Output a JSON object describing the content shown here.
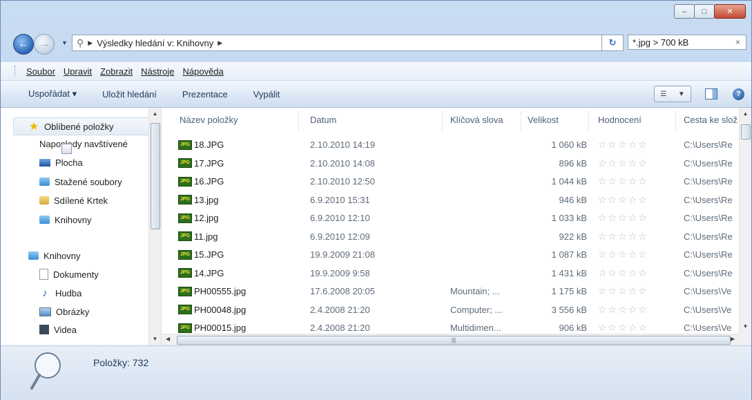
{
  "window": {
    "controls": {
      "minimize": "‒",
      "maximize": "□",
      "close": "✕"
    }
  },
  "address": {
    "breadcrumb": "Výsledky hledání v: Knihovny",
    "search_value": "*.jpg > 700 kB",
    "search_clear": "×"
  },
  "menu": [
    "Soubor",
    "Upravit",
    "Zobrazit",
    "Nástroje",
    "Nápověda"
  ],
  "commands": [
    "Uspořádat ▾",
    "Uložit hledání",
    "Prezentace",
    "Vypálit"
  ],
  "nav": {
    "favorites": {
      "label": "Oblíbené položky",
      "items": [
        "Naposledy navštívené",
        "Plocha",
        "Stažené soubory",
        "Sdílené Krtek",
        "Knihovny"
      ]
    },
    "libraries": {
      "label": "Knihovny",
      "items": [
        "Dokumenty",
        "Hudba",
        "Obrázky",
        "Videa"
      ]
    }
  },
  "columns": [
    "Název položky",
    "Datum",
    "Klíčová slova",
    "Velikost",
    "Hodnocení",
    "Cesta ke složce"
  ],
  "file_badge": "JPG",
  "rows": [
    {
      "name": "18.JPG",
      "date": "2.10.2010 14:19",
      "keywords": "",
      "size": "1 060 kB",
      "rating": "☆☆☆☆☆",
      "path": "C:\\Users\\Re"
    },
    {
      "name": "17.JPG",
      "date": "2.10.2010 14:08",
      "keywords": "",
      "size": "896 kB",
      "rating": "☆☆☆☆☆",
      "path": "C:\\Users\\Re"
    },
    {
      "name": "16.JPG",
      "date": "2.10.2010 12:50",
      "keywords": "",
      "size": "1 044 kB",
      "rating": "☆☆☆☆☆",
      "path": "C:\\Users\\Re"
    },
    {
      "name": "13.jpg",
      "date": "6.9.2010 15:31",
      "keywords": "",
      "size": "946 kB",
      "rating": "☆☆☆☆☆",
      "path": "C:\\Users\\Re"
    },
    {
      "name": "12.jpg",
      "date": "6.9.2010 12:10",
      "keywords": "",
      "size": "1 033 kB",
      "rating": "☆☆☆☆☆",
      "path": "C:\\Users\\Re"
    },
    {
      "name": "11.jpg",
      "date": "6.9.2010 12:09",
      "keywords": "",
      "size": "922 kB",
      "rating": "☆☆☆☆☆",
      "path": "C:\\Users\\Re"
    },
    {
      "name": "15.JPG",
      "date": "19.9.2009 21:08",
      "keywords": "",
      "size": "1 087 kB",
      "rating": "☆☆☆☆☆",
      "path": "C:\\Users\\Re"
    },
    {
      "name": "14.JPG",
      "date": "19.9.2009 9:58",
      "keywords": "",
      "size": "1 431 kB",
      "rating": "☆☆☆☆☆",
      "path": "C:\\Users\\Re"
    },
    {
      "name": "PH00555.jpg",
      "date": "17.6.2008 20:05",
      "keywords": "Mountain; ...",
      "size": "1 175 kB",
      "rating": "☆☆☆☆☆",
      "path": "C:\\Users\\Ve"
    },
    {
      "name": "PH00048.jpg",
      "date": "2.4.2008 21:20",
      "keywords": "Computer; ...",
      "size": "3 556 kB",
      "rating": "☆☆☆☆☆",
      "path": "C:\\Users\\Ve"
    },
    {
      "name": "PH00015.jpg",
      "date": "2.4.2008 21:20",
      "keywords": "Multidimen...",
      "size": "906 kB",
      "rating": "☆☆☆☆☆",
      "path": "C:\\Users\\Ve"
    }
  ],
  "details": {
    "count": "Položky: 732"
  }
}
